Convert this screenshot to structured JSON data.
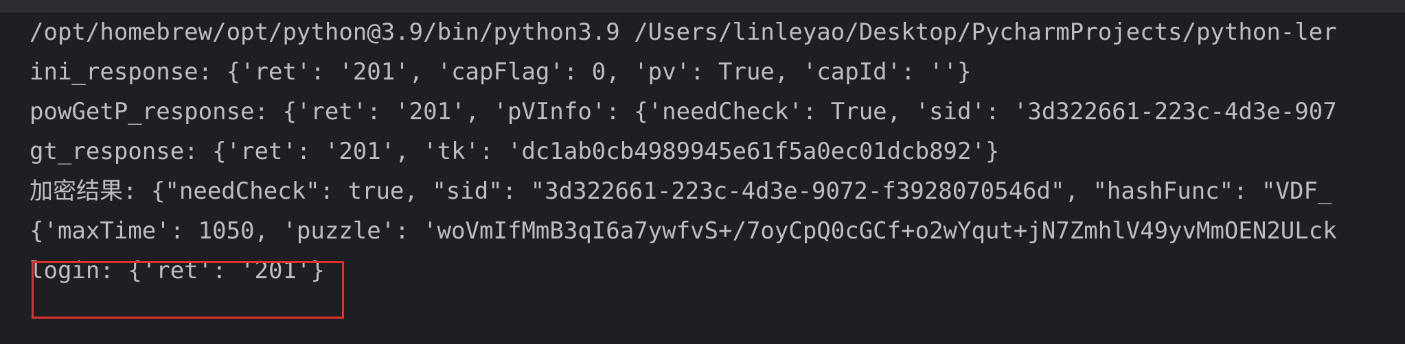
{
  "console": {
    "lines": [
      "/opt/homebrew/opt/python@3.9/bin/python3.9 /Users/linleyao/Desktop/PycharmProjects/python-ler",
      "ini_response: {'ret': '201', 'capFlag': 0, 'pv': True, 'capId': ''}",
      "powGetP_response: {'ret': '201', 'pVInfo': {'needCheck': True, 'sid': '3d322661-223c-4d3e-907",
      "gt_response: {'ret': '201', 'tk': 'dc1ab0cb4989945e61f5a0ec01dcb892'}",
      "加密结果: {\"needCheck\": true, \"sid\": \"3d322661-223c-4d3e-9072-f3928070546d\", \"hashFunc\": \"VDF_",
      "{'maxTime': 1050, 'puzzle': 'woVmIfMmB3qI6a7ywfvS+/7oyCpQ0cGCf+o2wYqut+jN7ZmhlV49yvMmOEN2ULck",
      "login: {'ret': '201'}"
    ]
  },
  "colors": {
    "background": "#1e1f22",
    "text": "#bcbec4",
    "highlight_border": "#e0312d"
  }
}
